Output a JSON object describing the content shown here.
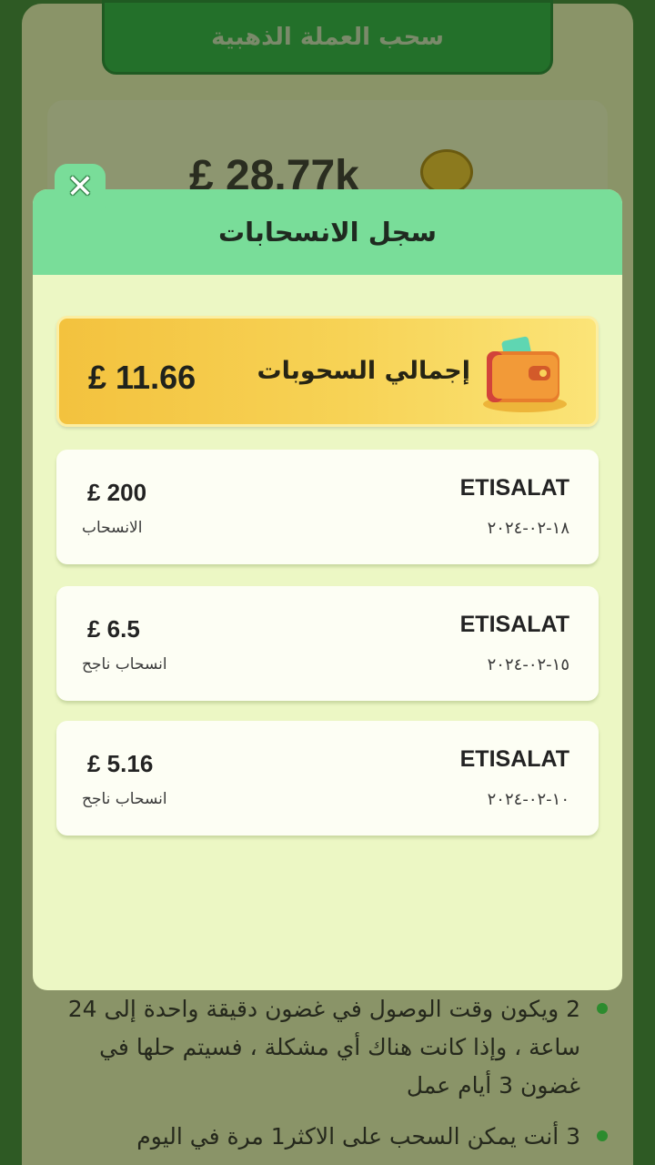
{
  "background": {
    "header_title": "سحب العملة الذهبية",
    "balance": "£ 28.77k",
    "coin_icon": "coin-icon",
    "notes": [
      "2 ويكون وقت الوصول في غضون دقيقة واحدة إلى 24 ساعة ، وإذا كانت هناك أي مشكلة ، فسيتم حلها في غضون 3 أيام عمل",
      "3 أنت يمكن السحب على الاكثر1 مرة في اليوم"
    ]
  },
  "modal": {
    "title": "سجل الانسحابات",
    "close_icon": "close-x-icon",
    "total": {
      "label": "إجمالي السحوبات",
      "amount": "£ 11.66",
      "icon": "wallet-icon"
    },
    "records": [
      {
        "method": "ETISALAT",
        "date": "١٨-٠٢-٢٠٢٤",
        "amount": "£ 200",
        "status": "الانسحاب"
      },
      {
        "method": "ETISALAT",
        "date": "١٥-٠٢-٢٠٢٤",
        "amount": "£ 6.5",
        "status": "انسحاب ناجح"
      },
      {
        "method": "ETISALAT",
        "date": "١٠-٠٢-٢٠٢٤",
        "amount": "£ 5.16",
        "status": "انسحاب ناجح"
      }
    ]
  },
  "colors": {
    "modal_header": "#79dd99",
    "modal_body": "#ecf7c4",
    "total_card": "#f5c842",
    "bullet": "#2c8b2e"
  }
}
